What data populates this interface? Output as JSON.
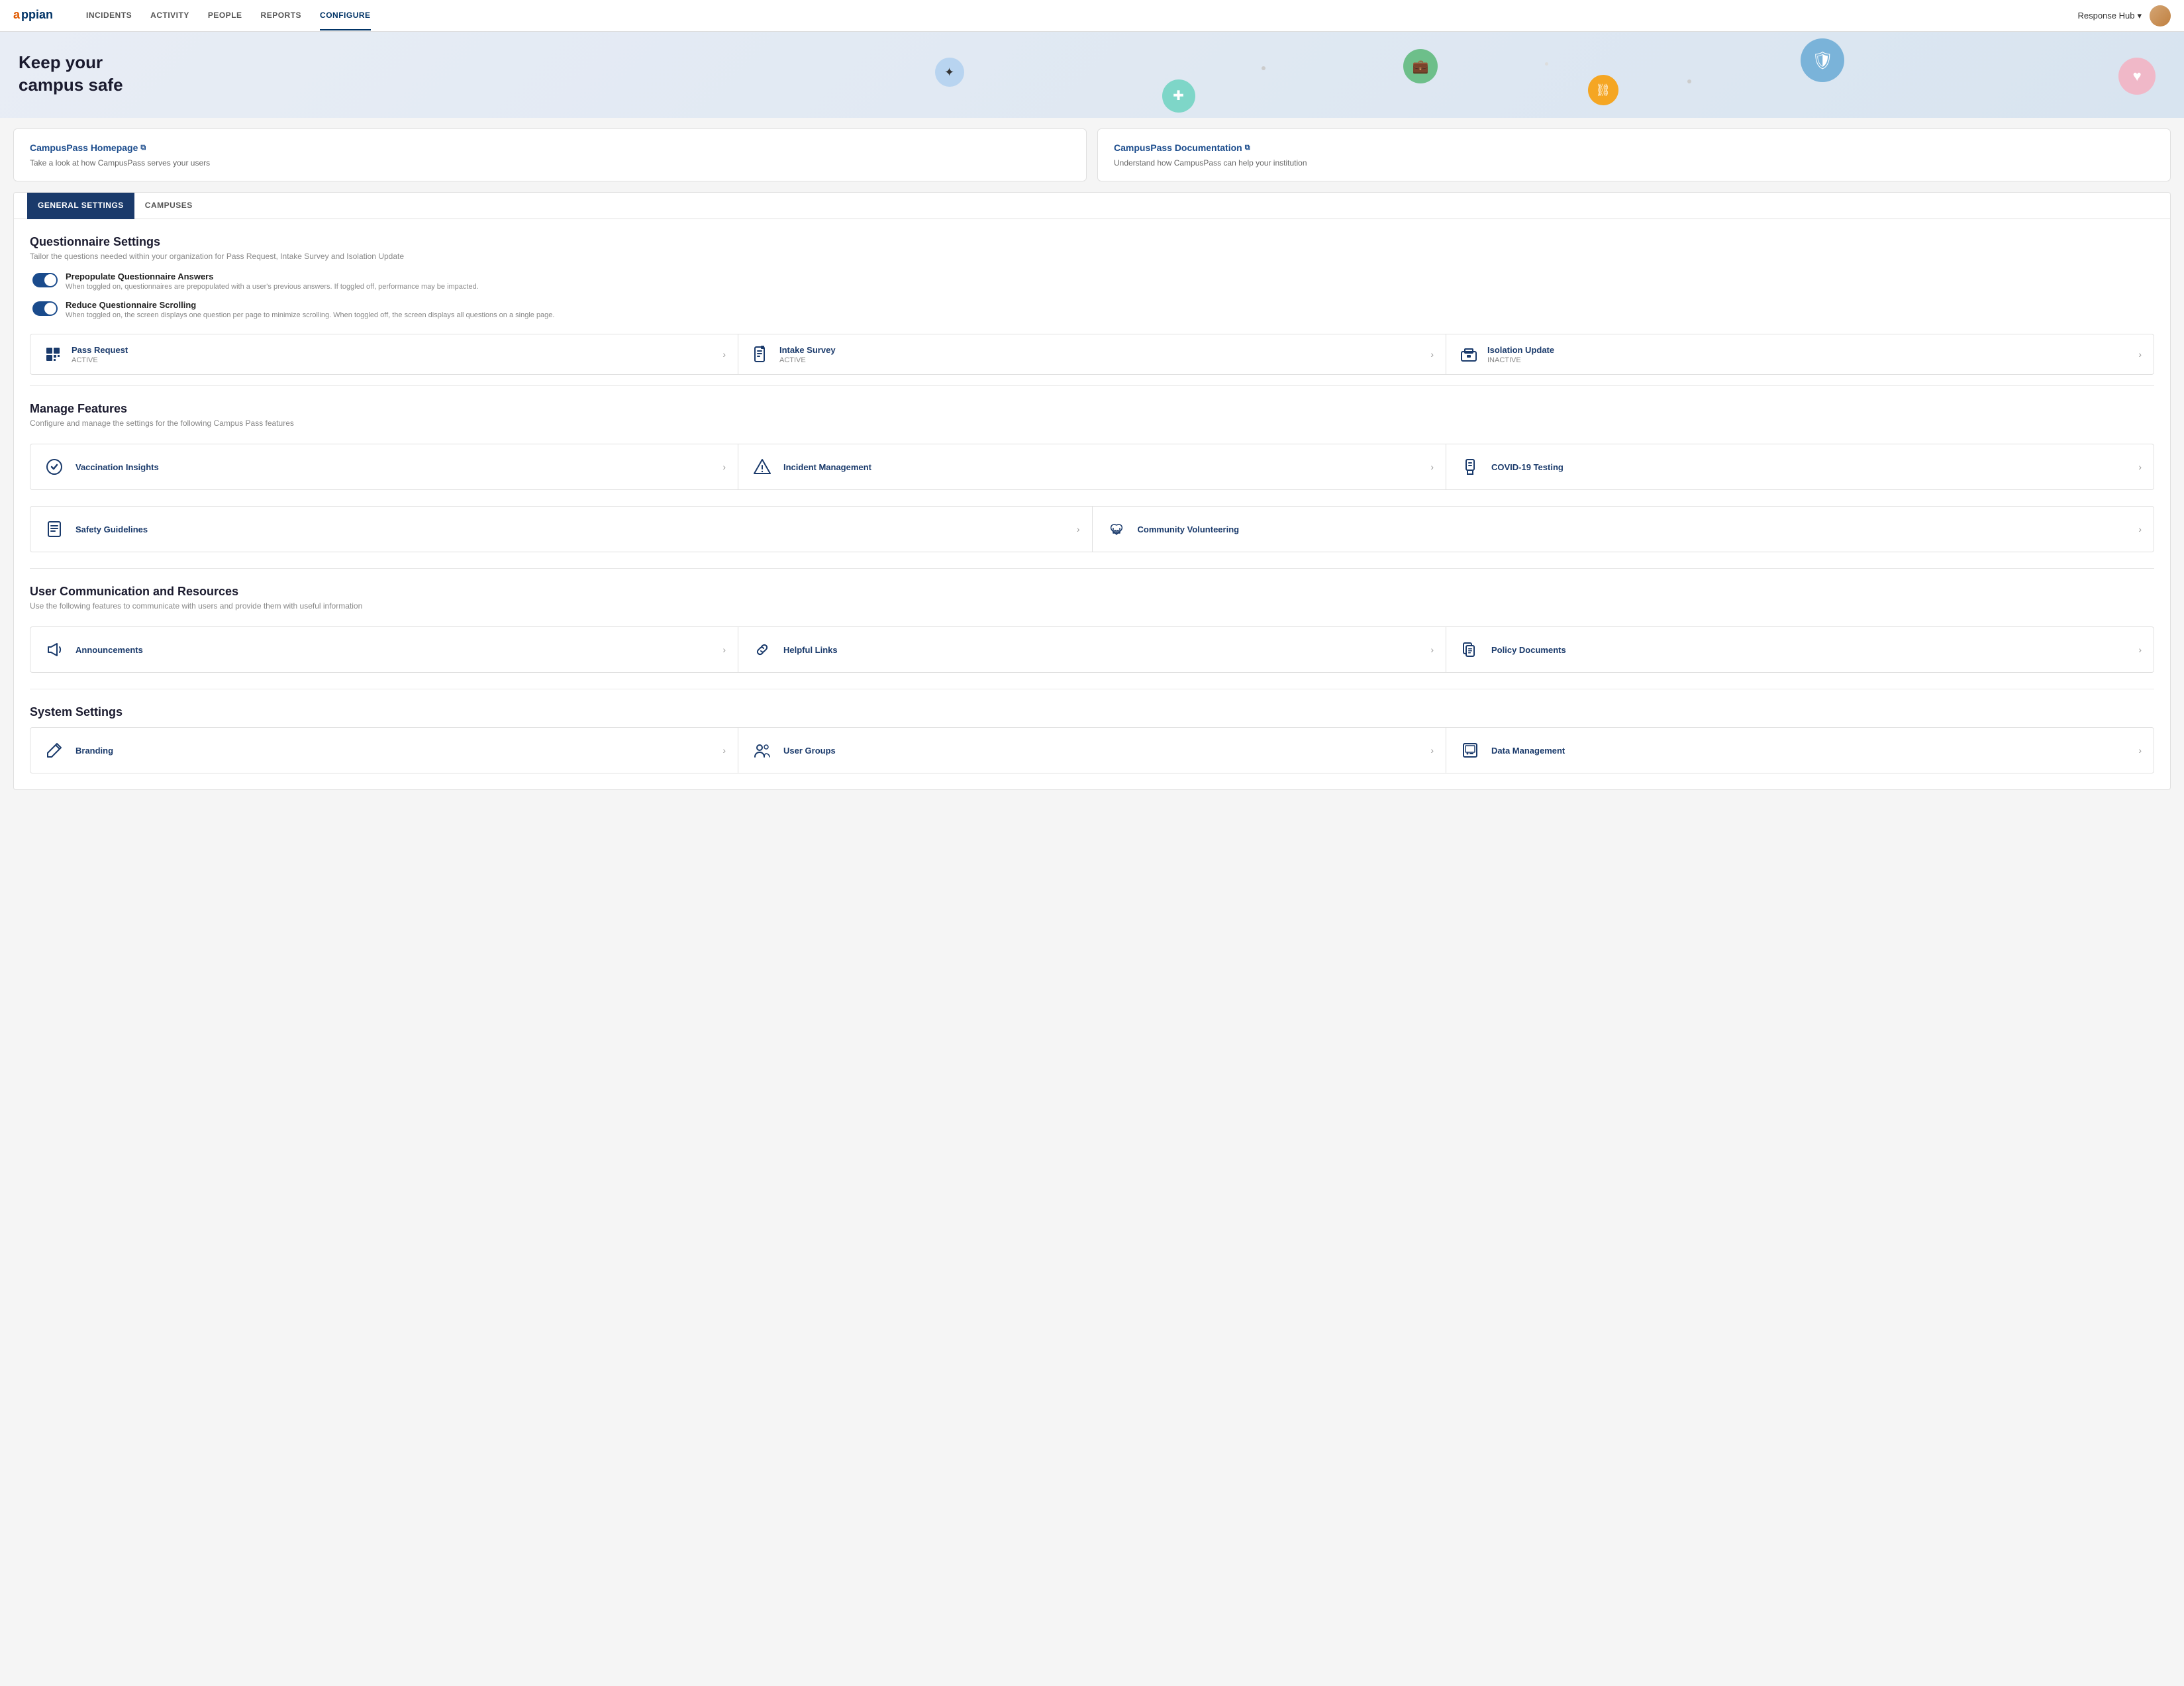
{
  "navbar": {
    "logo": "appian",
    "links": [
      "INCIDENTS",
      "ACTIVITY",
      "PEOPLE",
      "REPORTS",
      "CONFIGURE"
    ],
    "active_link": "CONFIGURE",
    "user_hub": "Response Hub",
    "chevron": "▾"
  },
  "hero": {
    "title_line1": "Keep your",
    "title_line2": "campus safe"
  },
  "info_cards": [
    {
      "id": "homepage",
      "title": "CampusPass Homepage",
      "ext_symbol": "⧉",
      "desc": "Take a look at how CampusPass serves your users"
    },
    {
      "id": "documentation",
      "title": "CampusPass Documentation",
      "ext_symbol": "⧉",
      "desc": "Understand how CampusPass can help your institution"
    }
  ],
  "tabs": [
    {
      "label": "GENERAL SETTINGS",
      "active": true
    },
    {
      "label": "CAMPUSES",
      "active": false
    }
  ],
  "questionnaire_settings": {
    "title": "Questionnaire Settings",
    "desc": "Tailor the questions needed within your organization for Pass Request, Intake Survey and Isolation Update",
    "toggles": [
      {
        "label": "Prepopulate Questionnaire Answers",
        "desc": "When toggled on, questionnaires are prepopulated with a user's previous answers. If toggled off, performance may be impacted."
      },
      {
        "label": "Reduce Questionnaire Scrolling",
        "desc": "When toggled on, the screen displays one question per page to minimize scrolling. When toggled off, the screen displays all questions on a single page."
      }
    ],
    "cards": [
      {
        "name": "Pass Request",
        "status": "ACTIVE"
      },
      {
        "name": "Intake Survey",
        "status": "ACTIVE"
      },
      {
        "name": "Isolation Update",
        "status": "INACTIVE"
      }
    ]
  },
  "manage_features": {
    "title": "Manage Features",
    "desc": "Configure and manage the settings for the following Campus Pass features",
    "items": [
      {
        "name": "Vaccination Insights",
        "icon": "shield"
      },
      {
        "name": "Incident Management",
        "icon": "warning"
      },
      {
        "name": "COVID-19 Testing",
        "icon": "briefcase"
      },
      {
        "name": "Safety Guidelines",
        "icon": "document"
      },
      {
        "name": "Community Volunteering",
        "icon": "hand"
      }
    ]
  },
  "user_communication": {
    "title": "User Communication and Resources",
    "desc": "Use the following features to communicate with users and provide them with useful information",
    "items": [
      {
        "name": "Announcements",
        "icon": "megaphone"
      },
      {
        "name": "Helpful Links",
        "icon": "link"
      },
      {
        "name": "Policy Documents",
        "icon": "copy"
      }
    ]
  },
  "system_settings": {
    "title": "System Settings",
    "items": [
      {
        "name": "Branding",
        "icon": "pen"
      },
      {
        "name": "User Groups",
        "icon": "users"
      },
      {
        "name": "Data Management",
        "icon": "floppy"
      }
    ]
  }
}
